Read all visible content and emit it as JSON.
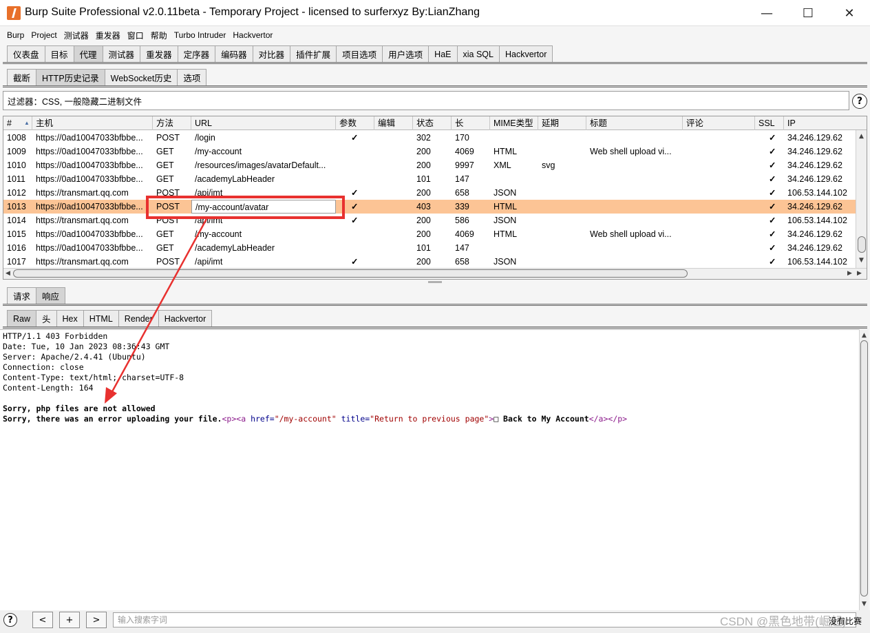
{
  "window": {
    "title": "Burp Suite Professional v2.0.11beta - Temporary Project - licensed to surferxyz By:LianZhang",
    "minimize": "—",
    "maximize": "☐",
    "close": "✕"
  },
  "menu": [
    "Burp",
    "Project",
    "测试器",
    "重发器",
    "窗口",
    "帮助",
    "Turbo Intruder",
    "Hackvertor"
  ],
  "main_tabs": [
    "仪表盘",
    "目标",
    "代理",
    "测试器",
    "重发器",
    "定序器",
    "编码器",
    "对比器",
    "插件扩展",
    "项目选项",
    "用户选项",
    "HaE",
    "xia SQL",
    "Hackvertor"
  ],
  "proxy_tabs": [
    "截断",
    "HTTP历史记录",
    "WebSocket历史",
    "选项"
  ],
  "filter": {
    "text": "过滤器：CSS, 一般隐藏二进制文件",
    "help": "?"
  },
  "table": {
    "columns": [
      "#",
      "主机",
      "方法",
      "URL",
      "参数",
      "编辑",
      "状态",
      "长",
      "MIME类型",
      "延期",
      "标题",
      "评论",
      "SSL",
      "IP"
    ],
    "sort_indicator": "▲",
    "check": "✓",
    "rows": [
      {
        "id": "1008",
        "host": "https://0ad10047033bfbbe...",
        "method": "POST",
        "url": "/login",
        "params": true,
        "status": "302",
        "length": "170",
        "mime": "",
        "ext": "",
        "title": "",
        "ssl": true,
        "ip": "34.246.129.62"
      },
      {
        "id": "1009",
        "host": "https://0ad10047033bfbbe...",
        "method": "GET",
        "url": "/my-account",
        "params": false,
        "status": "200",
        "length": "4069",
        "mime": "HTML",
        "ext": "",
        "title": "Web shell upload vi...",
        "ssl": true,
        "ip": "34.246.129.62"
      },
      {
        "id": "1010",
        "host": "https://0ad10047033bfbbe...",
        "method": "GET",
        "url": "/resources/images/avatarDefault...",
        "params": false,
        "status": "200",
        "length": "9997",
        "mime": "XML",
        "ext": "svg",
        "title": "",
        "ssl": true,
        "ip": "34.246.129.62"
      },
      {
        "id": "1011",
        "host": "https://0ad10047033bfbbe...",
        "method": "GET",
        "url": "/academyLabHeader",
        "params": false,
        "status": "101",
        "length": "147",
        "mime": "",
        "ext": "",
        "title": "",
        "ssl": true,
        "ip": "34.246.129.62"
      },
      {
        "id": "1012",
        "host": "https://transmart.qq.com",
        "method": "POST",
        "url": "/api/imt",
        "params": true,
        "status": "200",
        "length": "658",
        "mime": "JSON",
        "ext": "",
        "title": "",
        "ssl": true,
        "ip": "106.53.144.102"
      },
      {
        "id": "1013",
        "host": "https://0ad10047033bfbbe...",
        "method": "POST",
        "url": "/my-account/avatar",
        "params": true,
        "status": "403",
        "length": "339",
        "mime": "HTML",
        "ext": "",
        "title": "",
        "ssl": true,
        "ip": "34.246.129.62",
        "selected": true
      },
      {
        "id": "1014",
        "host": "https://transmart.qq.com",
        "method": "POST",
        "url": "/api/imt",
        "params": true,
        "status": "200",
        "length": "586",
        "mime": "JSON",
        "ext": "",
        "title": "",
        "ssl": true,
        "ip": "106.53.144.102"
      },
      {
        "id": "1015",
        "host": "https://0ad10047033bfbbe...",
        "method": "GET",
        "url": "/my-account",
        "params": false,
        "status": "200",
        "length": "4069",
        "mime": "HTML",
        "ext": "",
        "title": "Web shell upload vi...",
        "ssl": true,
        "ip": "34.246.129.62"
      },
      {
        "id": "1016",
        "host": "https://0ad10047033bfbbe...",
        "method": "GET",
        "url": "/academyLabHeader",
        "params": false,
        "status": "101",
        "length": "147",
        "mime": "",
        "ext": "",
        "title": "",
        "ssl": true,
        "ip": "34.246.129.62"
      },
      {
        "id": "1017",
        "host": "https://transmart.qq.com",
        "method": "POST",
        "url": "/api/imt",
        "params": true,
        "status": "200",
        "length": "658",
        "mime": "JSON",
        "ext": "",
        "title": "",
        "ssl": true,
        "ip": "106.53.144.102"
      }
    ]
  },
  "msg_tabs": [
    "请求",
    "响应"
  ],
  "view_tabs": [
    "Raw",
    "头",
    "Hex",
    "HTML",
    "Render",
    "Hackvertor"
  ],
  "response": {
    "headers": [
      "HTTP/1.1 403 Forbidden",
      "Date: Tue, 10 Jan 2023 08:36:43 GMT",
      "Server: Apache/2.4.41 (Ubuntu)",
      "Connection: close",
      "Content-Type: text/html; charset=UTF-8",
      "Content-Length: 164"
    ],
    "body1": "Sorry, php files are not allowed",
    "body2_text": "Sorry, there was an error uploading your file.",
    "tag_p_open": "<p>",
    "tag_a_open": "<a ",
    "attr_href": "href=",
    "val_href": "\"/my-account\"",
    "attr_title": " title=",
    "val_title": "\"Return to previous page\"",
    "tag_close": ">",
    "link_text": "□ Back to My Account",
    "tag_a_close": "</a>",
    "tag_p_close": "</p>"
  },
  "bottom": {
    "help": "?",
    "prev": "<",
    "add": "+",
    "next": ">",
    "search_placeholder": "输入搜索字词",
    "watermark": "CSDN @黑色地带(崛起)",
    "no_match": "没有比赛"
  }
}
